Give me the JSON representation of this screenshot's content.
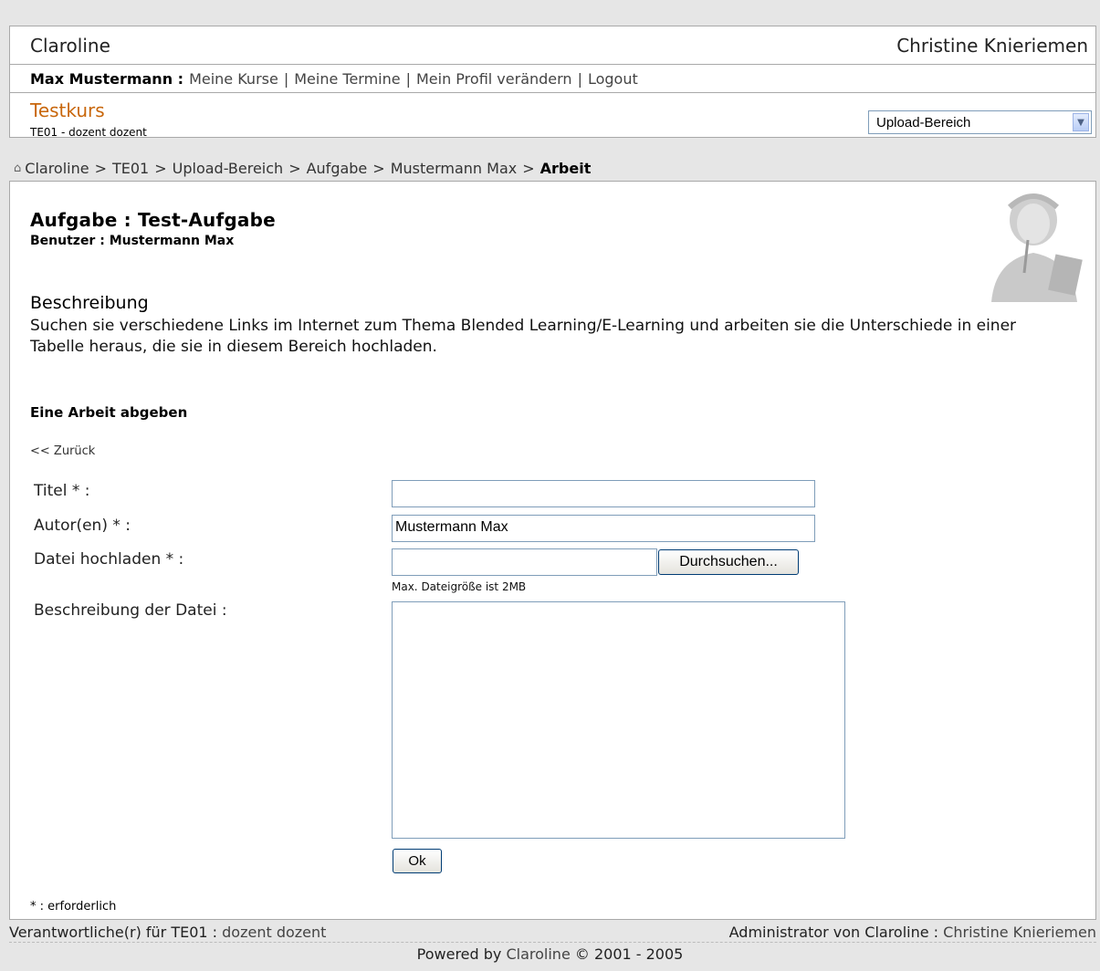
{
  "header": {
    "site_name": "Claroline",
    "institution": "Christine Knieriemen"
  },
  "user_bar": {
    "user_name": "Max Mustermann :",
    "links": [
      "Meine Kurse",
      "Meine Termine",
      "Mein Profil verändern",
      "Logout"
    ],
    "separator": "|"
  },
  "course": {
    "title": "Testkurs",
    "subtitle": "TE01 - dozent dozent",
    "tool_select": "Upload-Bereich"
  },
  "breadcrumb": {
    "items": [
      "Claroline",
      "TE01",
      "Upload-Bereich",
      "Aufgabe",
      "Mustermann Max"
    ],
    "current": "Arbeit",
    "separator": ">"
  },
  "assignment": {
    "label": "Aufgabe :",
    "name": "Test-Aufgabe",
    "user_label": "Benutzer :",
    "user_value": "Mustermann Max",
    "desc_heading": "Beschreibung",
    "description": "Suchen sie verschiedene Links im Internet zum Thema Blended Learning/E-Learning und arbeiten sie die Unterschiede in einer Tabelle heraus, die sie in diesem Bereich hochladen."
  },
  "form": {
    "heading": "Eine Arbeit abgeben",
    "back_link": "<< Zurück",
    "title_label": "Titel * :",
    "title_value": "",
    "authors_label": "Autor(en) * :",
    "authors_value": "Mustermann Max",
    "file_label": "Datei hochladen * :",
    "browse_button": "Durchsuchen...",
    "max_size_hint": "Max. Dateigröße ist 2MB",
    "file_desc_label": "Beschreibung der Datei :",
    "ok_button": "Ok",
    "required_note": "* : erforderlich"
  },
  "footer": {
    "responsible_label": "Verantwortliche(r) für TE01 :",
    "responsible_name": "dozent dozent",
    "admin_label": "Administrator von Claroline :",
    "admin_name": "Christine Knieriemen",
    "powered_prefix": "Powered by",
    "powered_link": "Claroline",
    "powered_suffix": "© 2001 - 2005"
  },
  "colors": {
    "course_title": "#c8660a",
    "page_bg": "#e6e6e6"
  }
}
